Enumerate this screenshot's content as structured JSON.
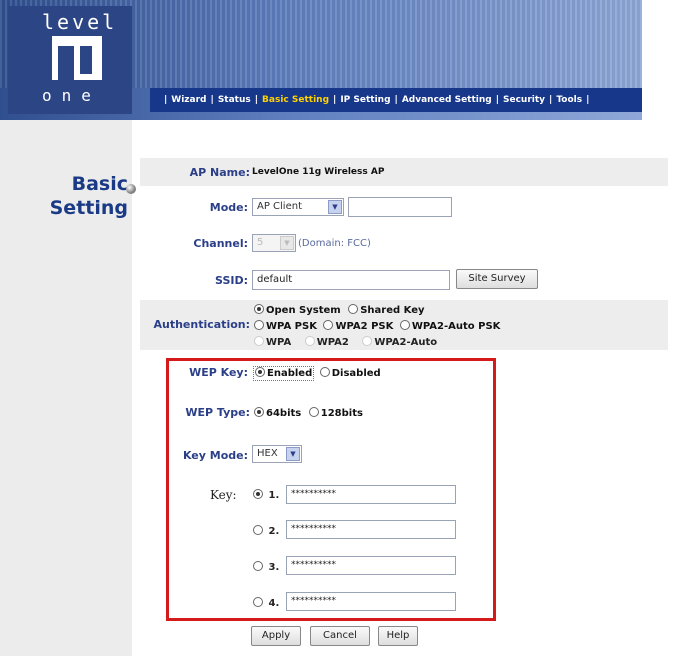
{
  "header": {
    "logo": {
      "word_top": "level",
      "word_bottom": "one",
      "brand": "LevelOne"
    },
    "nav": [
      {
        "label": "Wizard",
        "active": false
      },
      {
        "label": "Status",
        "active": false
      },
      {
        "label": "Basic Setting",
        "active": true
      },
      {
        "label": "IP Setting",
        "active": false
      },
      {
        "label": "Advanced Setting",
        "active": false
      },
      {
        "label": "Security",
        "active": false
      },
      {
        "label": "Tools",
        "active": false
      }
    ]
  },
  "sidebar": {
    "title_line1": "Basic",
    "title_line2": "Setting"
  },
  "form": {
    "ap_name": {
      "label": "AP Name:",
      "value": "LevelOne 11g Wireless AP"
    },
    "mode": {
      "label": "Mode:",
      "selected": "AP Client",
      "extra_value": ""
    },
    "channel": {
      "label": "Channel:",
      "selected": "5",
      "domain_note": "(Domain: FCC)"
    },
    "ssid": {
      "label": "SSID:",
      "value": "default",
      "button": "Site Survey"
    },
    "authentication": {
      "label": "Authentication:",
      "options": [
        {
          "label": "Open System",
          "checked": true
        },
        {
          "label": "Shared Key",
          "checked": false
        },
        {
          "label": "WPA PSK",
          "checked": false
        },
        {
          "label": "WPA2 PSK",
          "checked": false
        },
        {
          "label": "WPA2-Auto PSK",
          "checked": false
        },
        {
          "label": "WPA",
          "checked": false
        },
        {
          "label": "WPA2",
          "checked": false
        },
        {
          "label": "WPA2-Auto",
          "checked": false
        }
      ]
    },
    "wep_key": {
      "label": "WEP Key:",
      "enabled": "Enabled",
      "disabled": "Disabled"
    },
    "wep_type": {
      "label": "WEP Type:",
      "opt1": "64bits",
      "opt2": "128bits"
    },
    "key_mode": {
      "label": "Key Mode:",
      "selected": "HEX"
    },
    "keys": {
      "label": "Key:",
      "items": [
        {
          "num": "1.",
          "value": "**********",
          "checked": true
        },
        {
          "num": "2.",
          "value": "**********",
          "checked": false
        },
        {
          "num": "3.",
          "value": "**********",
          "checked": false
        },
        {
          "num": "4.",
          "value": "**********",
          "checked": false
        }
      ]
    }
  },
  "buttons": {
    "apply": "Apply",
    "cancel": "Cancel",
    "help": "Help"
  },
  "colors": {
    "nav_bg": "#17378a",
    "nav_active": "#ffd200",
    "label_blue": "#2b3f88",
    "highlight_box": "#d41a1a"
  }
}
